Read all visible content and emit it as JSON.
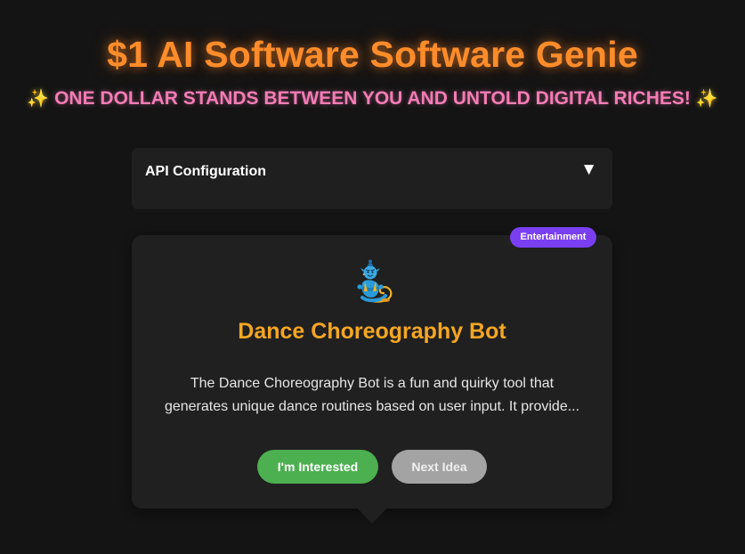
{
  "header": {
    "title": "$1 AI Software Software Genie",
    "subtitle_text": "ONE DOLLAR STANDS BETWEEN YOU AND UNTOLD DIGITAL RICHES!",
    "sparkle": "✨"
  },
  "api_config": {
    "label": "API Configuration",
    "toggle_glyph": "▼",
    "expanded": false
  },
  "idea_card": {
    "category": "Entertainment",
    "icon": "genie-icon",
    "title": "Dance Choreography Bot",
    "description": "The Dance Choreography Bot is a fun and quirky tool that generates unique dance routines based on user input. It provide...",
    "interested_label": "I'm Interested",
    "next_label": "Next Idea"
  },
  "colors": {
    "background": "#141414",
    "title": "#ff8c2a",
    "subtitle": "#f47cb6",
    "panel": "#1f1f1f",
    "card": "#202020",
    "badge": "#7b3ff2",
    "idea_title": "#f5a623",
    "interested_button": "#4caf50",
    "next_button": "#a3a3a3"
  }
}
